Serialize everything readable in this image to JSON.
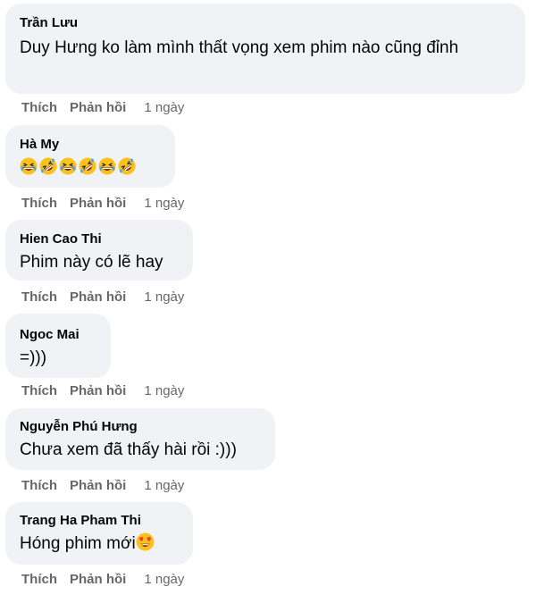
{
  "comments": [
    {
      "author": "Trần Lưu",
      "text": "Duy Hưng ko làm mình thất vọng xem phim nào cũng đỉnh",
      "like_label": "Thích",
      "reply_label": "Phản hồi",
      "time": "1 ngày"
    },
    {
      "author": "Hà My",
      "emojis": [
        "grinning-squinting-face",
        "rolling-on-floor-laughing",
        "grinning-squinting-face",
        "rolling-on-floor-laughing",
        "grinning-squinting-face",
        "rolling-on-floor-laughing"
      ],
      "like_label": "Thích",
      "reply_label": "Phản hồi",
      "time": "1 ngày"
    },
    {
      "author": "Hien Cao Thi",
      "text": "Phim này có lẽ hay",
      "like_label": "Thích",
      "reply_label": "Phản hồi",
      "time": "1 ngày"
    },
    {
      "author": "Ngoc Mai",
      "text": "=)))",
      "like_label": "Thích",
      "reply_label": "Phản hồi",
      "time": "1 ngày"
    },
    {
      "author": "Nguyễn Phú Hưng",
      "text": "Chưa xem đã thấy hài rồi :)))",
      "like_label": "Thích",
      "reply_label": "Phản hồi",
      "time": "1 ngày"
    },
    {
      "author": "Trang Ha Pham Thi",
      "text": "Hóng phim mới",
      "trailing_emoji": "smiling-face-with-heart-eyes",
      "like_label": "Thích",
      "reply_label": "Phản hồi",
      "time": "1 ngày"
    }
  ],
  "colors": {
    "bubble": "#f0f2f5",
    "text": "#050505",
    "meta": "#65676b",
    "emoji_yellow": "#fcc21b",
    "emoji_tear": "#3da6f5",
    "heart": "#f03e3e"
  }
}
